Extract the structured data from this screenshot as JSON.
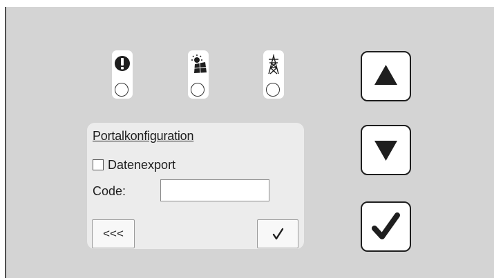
{
  "indicators": [
    {
      "name": "warning",
      "icon": "exclamation-icon"
    },
    {
      "name": "solar",
      "icon": "sun-panel-icon"
    },
    {
      "name": "grid",
      "icon": "power-pylon-icon"
    }
  ],
  "config": {
    "title": "Portalkonfiguration",
    "export_label": "Datenexport",
    "export_checked": false,
    "code_label": "Code:",
    "code_value": "",
    "back_label": "<<<",
    "confirm_icon": "checkmark-icon"
  },
  "nav": {
    "up_icon": "triangle-up-icon",
    "down_icon": "triangle-down-icon",
    "confirm_icon": "checkmark-icon"
  },
  "colors": {
    "panel_bg": "#d4d4d4",
    "box_bg": "#ececec",
    "icon_dark": "#1e1e1e"
  }
}
